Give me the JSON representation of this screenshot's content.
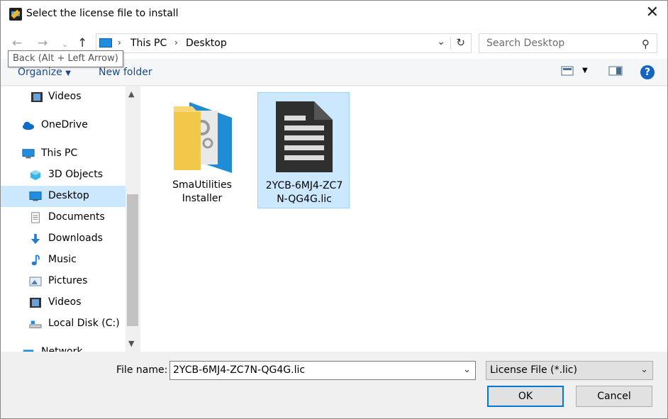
{
  "window": {
    "title": "Select the license file to install"
  },
  "nav": {
    "breadcrumbs": [
      "This PC",
      "Desktop"
    ],
    "search_placeholder": "Search Desktop",
    "tooltip": "Back (Alt + Left Arrow)"
  },
  "commands": {
    "organize": "Organize",
    "new_folder": "New folder"
  },
  "sidebar": {
    "items": [
      {
        "label": "Videos",
        "icon": "video-icon"
      },
      {
        "label": "OneDrive",
        "icon": "cloud-icon"
      },
      {
        "label": "This PC",
        "icon": "computer-icon"
      },
      {
        "label": "3D Objects",
        "icon": "cube-icon"
      },
      {
        "label": "Desktop",
        "icon": "desktop-icon",
        "selected": true
      },
      {
        "label": "Documents",
        "icon": "document-icon"
      },
      {
        "label": "Downloads",
        "icon": "download-icon"
      },
      {
        "label": "Music",
        "icon": "music-icon"
      },
      {
        "label": "Pictures",
        "icon": "picture-icon"
      },
      {
        "label": "Videos",
        "icon": "video-icon"
      },
      {
        "label": "Local Disk (C:)",
        "icon": "drive-icon"
      },
      {
        "label": "Network",
        "icon": "network-icon"
      }
    ]
  },
  "files": [
    {
      "name_line1": "SmaUtilities",
      "name_line2": "Installer",
      "icon": "folder-icon"
    },
    {
      "name_line1": "2YCB-6MJ4-ZC7",
      "name_line2": "N-QG4G.lic",
      "icon": "file-icon",
      "selected": true
    }
  ],
  "footer": {
    "file_name_label": "File name:",
    "file_name_value": "2YCB-6MJ4-ZC7N-QG4G.lic",
    "file_type_value": "License File (*.lic)",
    "ok_label": "OK",
    "cancel_label": "Cancel"
  },
  "colors": {
    "accent": "#0078d7",
    "selection": "#cce8ff",
    "link": "#1a4a8a"
  }
}
